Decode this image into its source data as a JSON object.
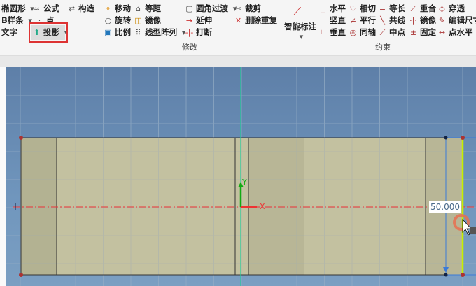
{
  "ribbon": {
    "draw": [
      {
        "label": "椭圆形",
        "icon": "ellipse-icon",
        "dropdown": true
      },
      {
        "label": "公式",
        "icon": "formula-icon"
      },
      {
        "label": "构造",
        "icon": "construct-icon"
      },
      {
        "label": "B样条",
        "dropdown": true
      },
      {
        "label": "点",
        "icon": "point-icon"
      },
      {
        "label": "文字"
      },
      {
        "label": "投影",
        "icon": "project-icon",
        "dropdown": true,
        "highlighted": true
      }
    ],
    "modify": {
      "label": "修改",
      "items": [
        {
          "label": "移动",
          "icon": "move-icon"
        },
        {
          "label": "等距",
          "icon": "offset-icon"
        },
        {
          "label": "圆角过渡",
          "icon": "fillet-icon",
          "dropdown": true
        },
        {
          "label": "裁剪",
          "icon": "trim-icon"
        },
        {
          "label": "旋转",
          "icon": "rotate-icon"
        },
        {
          "label": "镜像",
          "icon": "mirror-icon"
        },
        {
          "label": "延伸",
          "icon": "extend-icon"
        },
        {
          "label": "删除重复",
          "icon": "delete-duplicate-icon"
        },
        {
          "label": "比例",
          "icon": "scale-icon"
        },
        {
          "label": "线型阵列",
          "icon": "linear-pattern-icon",
          "dropdown": true
        },
        {
          "label": "打断",
          "icon": "break-icon"
        }
      ]
    },
    "constraint": {
      "label": "约束",
      "smart": "智能标注",
      "items": [
        {
          "label": "水平"
        },
        {
          "label": "相切"
        },
        {
          "label": "等长"
        },
        {
          "label": "重合"
        },
        {
          "label": "穿透"
        },
        {
          "label": "竖直"
        },
        {
          "label": "平行"
        },
        {
          "label": "共线"
        },
        {
          "label": "镜像"
        },
        {
          "label": "编辑尺寸"
        },
        {
          "label": "垂直"
        },
        {
          "label": "同轴"
        },
        {
          "label": "中点"
        },
        {
          "label": "固定"
        },
        {
          "label": "点水平"
        }
      ]
    }
  },
  "canvas": {
    "axis_x": "X",
    "axis_y": "Y",
    "dimension_value": "50.000"
  },
  "colors": {
    "accent": "#d33",
    "profile": "#c8c4a0",
    "selected_edge": "#c8f000"
  }
}
